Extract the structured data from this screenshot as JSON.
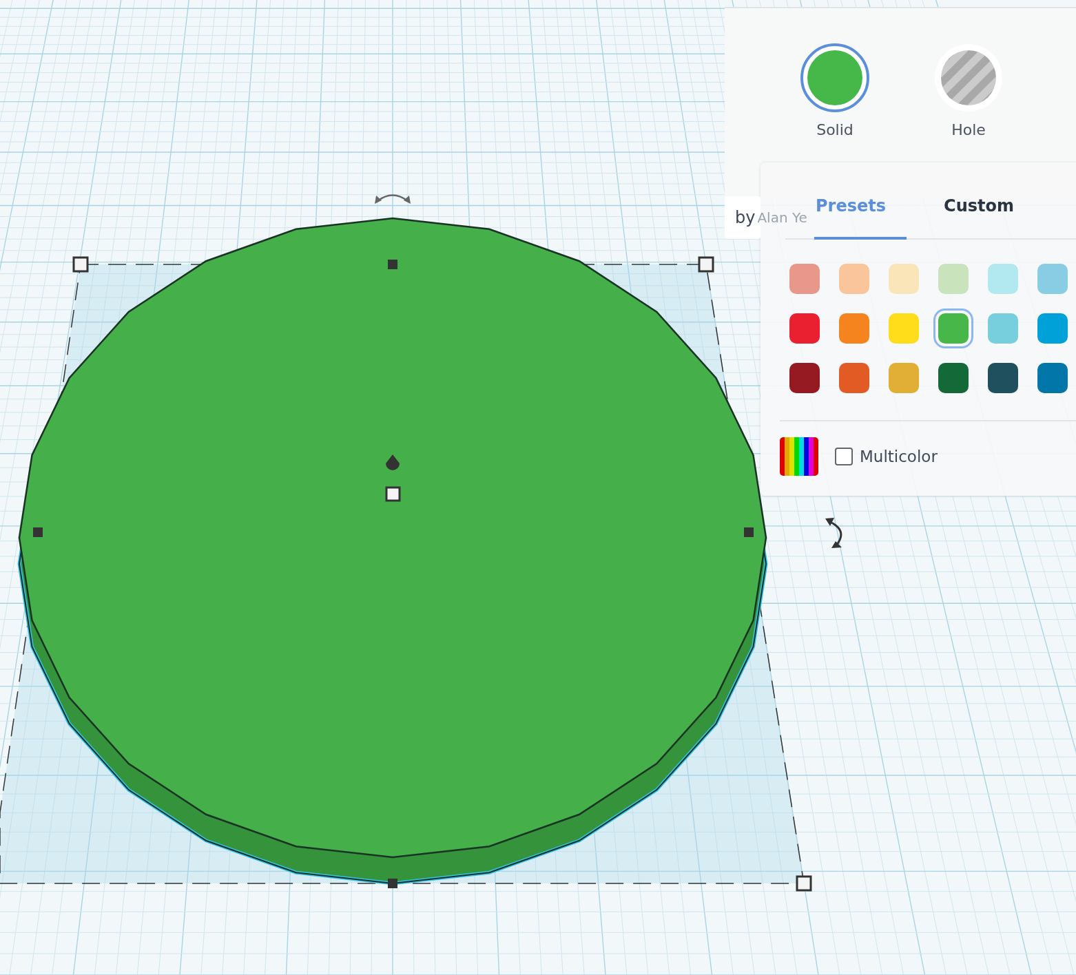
{
  "body_types": [
    {
      "label": "Solid",
      "kind": "solid",
      "selected": true
    },
    {
      "label": "Hole",
      "kind": "hole",
      "selected": false
    }
  ],
  "attribution": {
    "prefix": "by",
    "author": "Alan Ye"
  },
  "color_tabs": [
    {
      "label": "Presets",
      "selected": true
    },
    {
      "label": "Custom",
      "selected": false
    }
  ],
  "swatches": [
    {
      "color": "#e9968b",
      "selected": false
    },
    {
      "color": "#fac59a",
      "selected": false
    },
    {
      "color": "#fae5b8",
      "selected": false
    },
    {
      "color": "#c9e3bc",
      "selected": false
    },
    {
      "color": "#b2e8ef",
      "selected": false
    },
    {
      "color": "#89cde5",
      "selected": false
    },
    {
      "color": "#ea1f30",
      "selected": false
    },
    {
      "color": "#f5841f",
      "selected": false
    },
    {
      "color": "#ffdd1a",
      "selected": false
    },
    {
      "color": "#47b749",
      "selected": true
    },
    {
      "color": "#77cfdd",
      "selected": false
    },
    {
      "color": "#00a0d8",
      "selected": false
    },
    {
      "color": "#961a22",
      "selected": false
    },
    {
      "color": "#e25b24",
      "selected": false
    },
    {
      "color": "#e1ae36",
      "selected": false
    },
    {
      "color": "#136a38",
      "selected": false
    },
    {
      "color": "#1e505e",
      "selected": false
    },
    {
      "color": "#0276a8",
      "selected": false
    }
  ],
  "multicolor": {
    "label": "Multicolor",
    "checked": false
  }
}
